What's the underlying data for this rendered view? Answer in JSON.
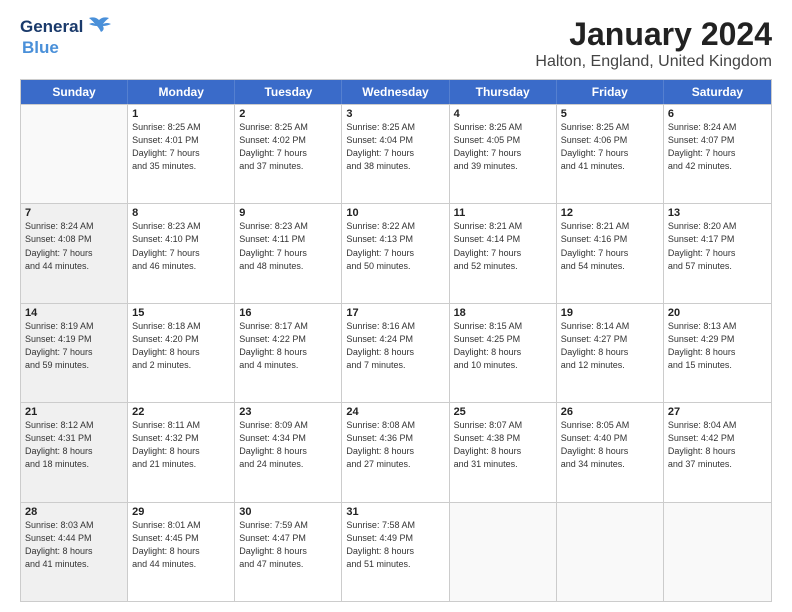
{
  "logo": {
    "line1": "General",
    "line2": "Blue"
  },
  "title": "January 2024",
  "subtitle": "Halton, England, United Kingdom",
  "days_of_week": [
    "Sunday",
    "Monday",
    "Tuesday",
    "Wednesday",
    "Thursday",
    "Friday",
    "Saturday"
  ],
  "weeks": [
    [
      {
        "day": "",
        "info": "",
        "empty": true
      },
      {
        "day": "1",
        "info": "Sunrise: 8:25 AM\nSunset: 4:01 PM\nDaylight: 7 hours\nand 35 minutes."
      },
      {
        "day": "2",
        "info": "Sunrise: 8:25 AM\nSunset: 4:02 PM\nDaylight: 7 hours\nand 37 minutes."
      },
      {
        "day": "3",
        "info": "Sunrise: 8:25 AM\nSunset: 4:04 PM\nDaylight: 7 hours\nand 38 minutes."
      },
      {
        "day": "4",
        "info": "Sunrise: 8:25 AM\nSunset: 4:05 PM\nDaylight: 7 hours\nand 39 minutes."
      },
      {
        "day": "5",
        "info": "Sunrise: 8:25 AM\nSunset: 4:06 PM\nDaylight: 7 hours\nand 41 minutes."
      },
      {
        "day": "6",
        "info": "Sunrise: 8:24 AM\nSunset: 4:07 PM\nDaylight: 7 hours\nand 42 minutes."
      }
    ],
    [
      {
        "day": "7",
        "info": "Sunrise: 8:24 AM\nSunset: 4:08 PM\nDaylight: 7 hours\nand 44 minutes.",
        "shaded": true
      },
      {
        "day": "8",
        "info": "Sunrise: 8:23 AM\nSunset: 4:10 PM\nDaylight: 7 hours\nand 46 minutes."
      },
      {
        "day": "9",
        "info": "Sunrise: 8:23 AM\nSunset: 4:11 PM\nDaylight: 7 hours\nand 48 minutes."
      },
      {
        "day": "10",
        "info": "Sunrise: 8:22 AM\nSunset: 4:13 PM\nDaylight: 7 hours\nand 50 minutes."
      },
      {
        "day": "11",
        "info": "Sunrise: 8:21 AM\nSunset: 4:14 PM\nDaylight: 7 hours\nand 52 minutes."
      },
      {
        "day": "12",
        "info": "Sunrise: 8:21 AM\nSunset: 4:16 PM\nDaylight: 7 hours\nand 54 minutes."
      },
      {
        "day": "13",
        "info": "Sunrise: 8:20 AM\nSunset: 4:17 PM\nDaylight: 7 hours\nand 57 minutes."
      }
    ],
    [
      {
        "day": "14",
        "info": "Sunrise: 8:19 AM\nSunset: 4:19 PM\nDaylight: 7 hours\nand 59 minutes.",
        "shaded": true
      },
      {
        "day": "15",
        "info": "Sunrise: 8:18 AM\nSunset: 4:20 PM\nDaylight: 8 hours\nand 2 minutes."
      },
      {
        "day": "16",
        "info": "Sunrise: 8:17 AM\nSunset: 4:22 PM\nDaylight: 8 hours\nand 4 minutes."
      },
      {
        "day": "17",
        "info": "Sunrise: 8:16 AM\nSunset: 4:24 PM\nDaylight: 8 hours\nand 7 minutes."
      },
      {
        "day": "18",
        "info": "Sunrise: 8:15 AM\nSunset: 4:25 PM\nDaylight: 8 hours\nand 10 minutes."
      },
      {
        "day": "19",
        "info": "Sunrise: 8:14 AM\nSunset: 4:27 PM\nDaylight: 8 hours\nand 12 minutes."
      },
      {
        "day": "20",
        "info": "Sunrise: 8:13 AM\nSunset: 4:29 PM\nDaylight: 8 hours\nand 15 minutes."
      }
    ],
    [
      {
        "day": "21",
        "info": "Sunrise: 8:12 AM\nSunset: 4:31 PM\nDaylight: 8 hours\nand 18 minutes.",
        "shaded": true
      },
      {
        "day": "22",
        "info": "Sunrise: 8:11 AM\nSunset: 4:32 PM\nDaylight: 8 hours\nand 21 minutes."
      },
      {
        "day": "23",
        "info": "Sunrise: 8:09 AM\nSunset: 4:34 PM\nDaylight: 8 hours\nand 24 minutes."
      },
      {
        "day": "24",
        "info": "Sunrise: 8:08 AM\nSunset: 4:36 PM\nDaylight: 8 hours\nand 27 minutes."
      },
      {
        "day": "25",
        "info": "Sunrise: 8:07 AM\nSunset: 4:38 PM\nDaylight: 8 hours\nand 31 minutes."
      },
      {
        "day": "26",
        "info": "Sunrise: 8:05 AM\nSunset: 4:40 PM\nDaylight: 8 hours\nand 34 minutes."
      },
      {
        "day": "27",
        "info": "Sunrise: 8:04 AM\nSunset: 4:42 PM\nDaylight: 8 hours\nand 37 minutes."
      }
    ],
    [
      {
        "day": "28",
        "info": "Sunrise: 8:03 AM\nSunset: 4:44 PM\nDaylight: 8 hours\nand 41 minutes.",
        "shaded": true
      },
      {
        "day": "29",
        "info": "Sunrise: 8:01 AM\nSunset: 4:45 PM\nDaylight: 8 hours\nand 44 minutes."
      },
      {
        "day": "30",
        "info": "Sunrise: 7:59 AM\nSunset: 4:47 PM\nDaylight: 8 hours\nand 47 minutes."
      },
      {
        "day": "31",
        "info": "Sunrise: 7:58 AM\nSunset: 4:49 PM\nDaylight: 8 hours\nand 51 minutes."
      },
      {
        "day": "",
        "info": "",
        "empty": true
      },
      {
        "day": "",
        "info": "",
        "empty": true
      },
      {
        "day": "",
        "info": "",
        "empty": true
      }
    ]
  ]
}
